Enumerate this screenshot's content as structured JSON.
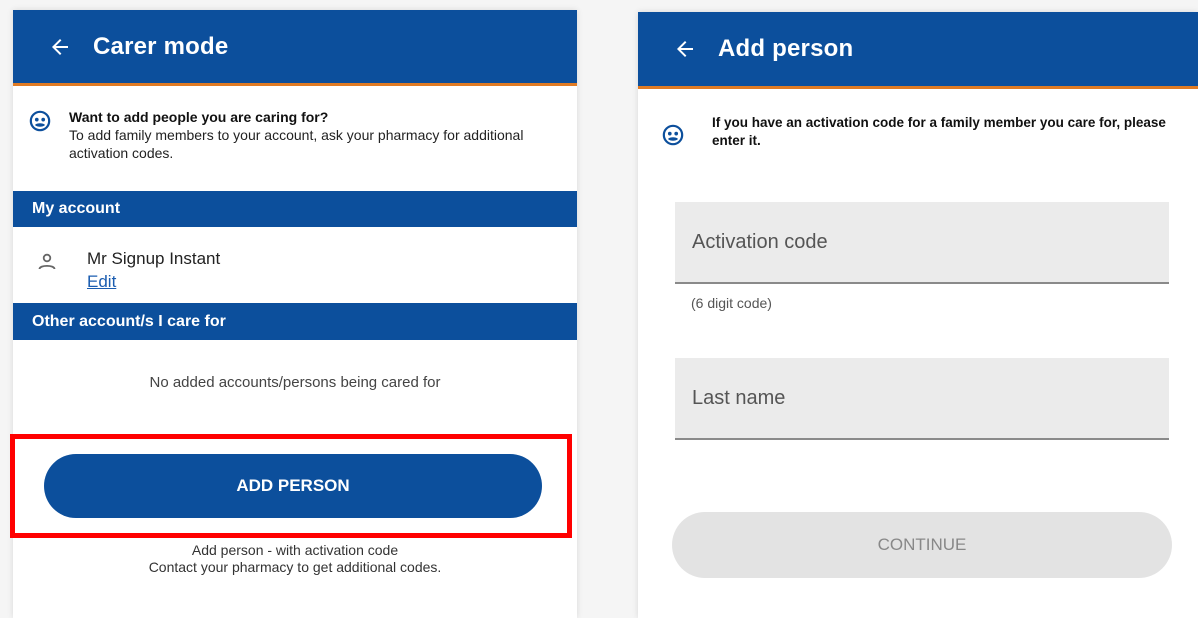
{
  "carer_mode": {
    "title": "Carer mode",
    "info": {
      "heading": "Want to add people you are caring for?",
      "body": "To add family members to your account, ask your pharmacy for additional activation codes."
    },
    "my_account": {
      "section_label": "My account",
      "name": "Mr Signup Instant",
      "edit_label": "Edit"
    },
    "others": {
      "section_label": "Other account/s I care for",
      "empty_text": "No added accounts/persons being cared for"
    },
    "add_person_label": "ADD PERSON",
    "helper_line1": "Add person - with activation code",
    "helper_line2": "Contact your pharmacy to get additional codes."
  },
  "add_person": {
    "title": "Add person",
    "info_text": "If you have an activation code for a family member you care for, please enter it.",
    "activation_code_placeholder": "Activation code",
    "activation_code_hint": "(6 digit code)",
    "last_name_placeholder": "Last name",
    "continue_label": "CONTINUE"
  },
  "colors": {
    "primary": "#0c4f9c",
    "accent_underline": "#e07b24",
    "highlight_border": "#ff0000"
  },
  "icons": [
    "back-arrow-icon",
    "pharmacist-face-icon",
    "person-icon"
  ]
}
